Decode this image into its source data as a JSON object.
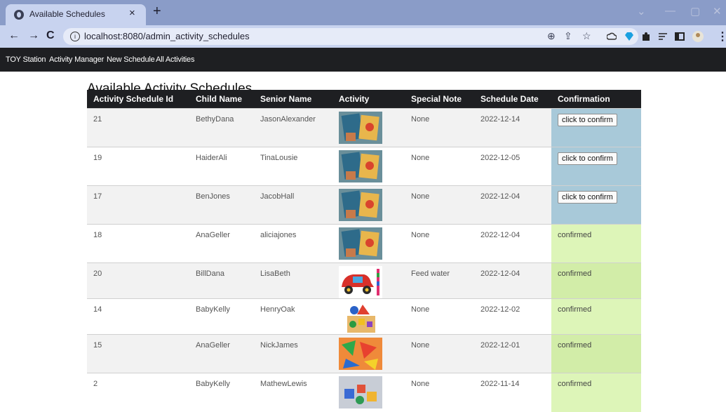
{
  "browser": {
    "tab_title": "Available Schedules",
    "tab_close": "×",
    "new_tab": "+",
    "url": "localhost:8080/admin_activity_schedules",
    "back": "←",
    "forward": "→",
    "reload": "C",
    "minimize": "—",
    "maximize": "▢",
    "close": "✕",
    "chevron": "⌄"
  },
  "nav": {
    "items": [
      "TOY Station",
      "Activity Manager",
      "New Schedule",
      "All Activities"
    ]
  },
  "page": {
    "title": "Available Activity Schedules",
    "columns": [
      "Activity Schedule Id",
      "Child Name",
      "Senior Name",
      "Activity",
      "Special Note",
      "Schedule Date",
      "Confirmation"
    ],
    "confirm_label": "click to confirm",
    "rows": [
      {
        "id": "21",
        "child": "BethyDana",
        "senior": "JasonAlexander",
        "activity_icon": "book-toy-image",
        "note": "None",
        "date": "2022-12-14",
        "confirmation": "click to confirm",
        "status": "pending"
      },
      {
        "id": "19",
        "child": "HaiderAli",
        "senior": "TinaLousie",
        "activity_icon": "book-toy-image",
        "note": "None",
        "date": "2022-12-05",
        "confirmation": "click to confirm",
        "status": "pending"
      },
      {
        "id": "17",
        "child": "BenJones",
        "senior": "JacobHall",
        "activity_icon": "book-toy-image",
        "note": "None",
        "date": "2022-12-04",
        "confirmation": "click to confirm",
        "status": "pending"
      },
      {
        "id": "18",
        "child": "AnaGeller",
        "senior": "aliciajones",
        "activity_icon": "book-toy-image",
        "note": "None",
        "date": "2022-12-04",
        "confirmation": "confirmed",
        "status": "confirmed"
      },
      {
        "id": "20",
        "child": "BillDana",
        "senior": "LisaBeth",
        "activity_icon": "toy-car-image",
        "note": "Feed water",
        "date": "2022-12-04",
        "confirmation": "confirmed",
        "status": "confirmed"
      },
      {
        "id": "14",
        "child": "BabyKelly",
        "senior": "HenryOak",
        "activity_icon": "shape-sorter-image",
        "note": "None",
        "date": "2022-12-02",
        "confirmation": "confirmed",
        "status": "confirmed"
      },
      {
        "id": "15",
        "child": "AnaGeller",
        "senior": "NickJames",
        "activity_icon": "paper-shapes-image",
        "note": "None",
        "date": "2022-12-01",
        "confirmation": "confirmed",
        "status": "confirmed"
      },
      {
        "id": "2",
        "child": "BabyKelly",
        "senior": "MathewLewis",
        "activity_icon": "building-blocks-image",
        "note": "None",
        "date": "2022-11-14",
        "confirmation": "confirmed",
        "status": "confirmed"
      }
    ]
  },
  "colors": {
    "nav_bg": "#1e1f22",
    "pending_bg": "#a8c9d9",
    "confirmed_bg": "#ddf5b8",
    "tabbar_bg": "#8a9cc8"
  }
}
